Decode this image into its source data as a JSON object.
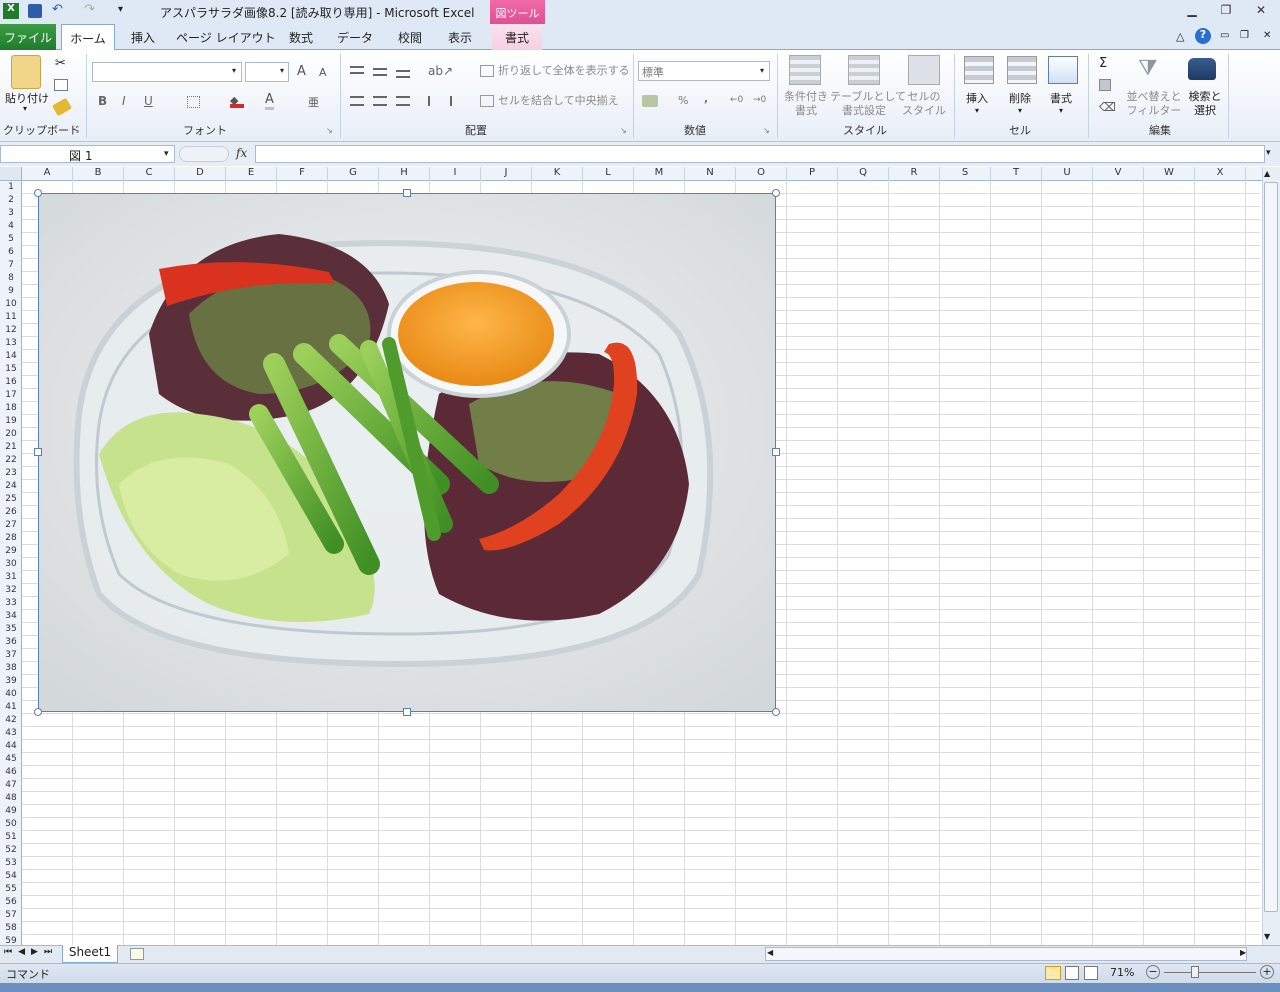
{
  "window": {
    "title": "アスパラサラダ画像8.2  [読み取り専用] - Microsoft Excel",
    "context_tab_group": "図ツール"
  },
  "tabs": [
    "ファイル",
    "ホーム",
    "挿入",
    "ページ レイアウト",
    "数式",
    "データ",
    "校閲",
    "表示",
    "書式"
  ],
  "ribbon": {
    "clipboard": {
      "paste_label": "貼り付け",
      "group_label": "クリップボード"
    },
    "font": {
      "group_label": "フォント",
      "font_name": "",
      "font_size": ""
    },
    "alignment": {
      "wrap_text": "折り返して全体を表示する",
      "merge_center": "セルを結合して中央揃え",
      "group_label": "配置"
    },
    "number": {
      "format": "標準",
      "percent": "%",
      "comma": ",",
      "group_label": "数値"
    },
    "styles": {
      "conditional_line1": "条件付き",
      "conditional_line2": "書式",
      "table_line1": "テーブルとして",
      "table_line2": "書式設定",
      "cell_line1": "セルの",
      "cell_line2": "スタイル",
      "group_label": "スタイル"
    },
    "cells": {
      "insert": "挿入",
      "delete": "削除",
      "format": "書式",
      "group_label": "セル"
    },
    "editing": {
      "sigma": "Σ",
      "sort_line1": "並べ替えと",
      "sort_line2": "フィルター",
      "find_line1": "検索と",
      "find_line2": "選択",
      "group_label": "編集"
    }
  },
  "formula_bar": {
    "name_box": "図 1",
    "fx": "fx",
    "value": ""
  },
  "grid": {
    "columns": [
      "A",
      "B",
      "C",
      "D",
      "E",
      "F",
      "G",
      "H",
      "I",
      "J",
      "K",
      "L",
      "M",
      "N",
      "O",
      "P",
      "Q",
      "R",
      "S",
      "T",
      "U",
      "V",
      "W",
      "X"
    ],
    "rows": [
      "1",
      "2",
      "3",
      "4",
      "5",
      "6",
      "7",
      "8",
      "9",
      "10",
      "11",
      "12",
      "13",
      "14",
      "15",
      "16",
      "17",
      "18",
      "19",
      "20",
      "21",
      "22",
      "23",
      "24",
      "25",
      "26",
      "27",
      "28",
      "29",
      "30",
      "31",
      "32",
      "33",
      "34",
      "35",
      "36",
      "37",
      "38",
      "39",
      "40",
      "41",
      "42",
      "43",
      "44",
      "45",
      "46",
      "47",
      "48",
      "49",
      "50",
      "51",
      "52",
      "53",
      "54",
      "55",
      "56",
      "57",
      "58",
      "59"
    ]
  },
  "picture": {
    "name": "図 1",
    "subject": "asparagus salad with dressing in a clear container"
  },
  "sheets": [
    "Sheet1"
  ],
  "status": {
    "mode": "コマンド",
    "zoom": "71%"
  },
  "colors": {
    "file_tab": "#1f7b2c",
    "context_tab": "#e04f93",
    "selection_border": "#5b7fb2"
  }
}
